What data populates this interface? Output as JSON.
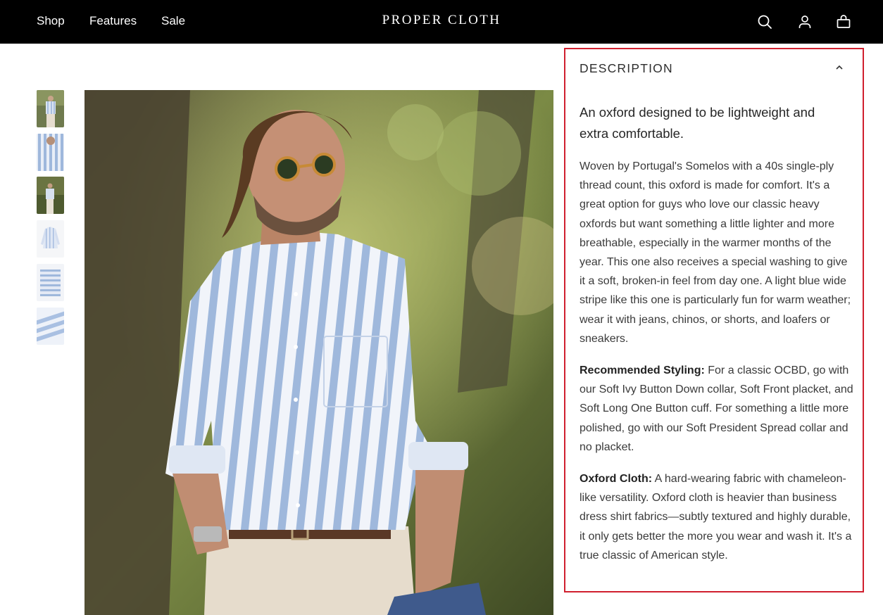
{
  "header": {
    "nav": [
      {
        "label": "Shop"
      },
      {
        "label": "Features"
      },
      {
        "label": "Sale"
      }
    ],
    "brand": "PROPER CLOTH",
    "icons": [
      "search-icon",
      "account-icon",
      "cart-icon"
    ]
  },
  "gallery": {
    "thumbnail_count": 6,
    "main_image": "man-wearing-blue-wide-stripe-oxford-shirt"
  },
  "description": {
    "title": "DESCRIPTION",
    "expanded": true,
    "lead": "An oxford designed to be lightweight and extra comfortable.",
    "body": "Woven by Portugal's Somelos with a 40s single-ply thread count, this oxford is made for comfort. It's a great option for guys who love our classic heavy oxfords but want something a little lighter and more breathable, especially in the warmer months of the year. This one also receives a special washing to give it a soft, broken-in feel from day one. A light blue wide stripe like this one is particularly fun for warm weather; wear it with jeans, chinos, or shorts, and loafers or sneakers.",
    "styling_label": "Recommended Styling:",
    "styling_text": " For a classic OCBD, go with our Soft Ivy Button Down collar, Soft Front placket, and Soft Long One Button cuff. For something a little more polished, go with our Soft President Spread collar and no placket.",
    "cloth_label": "Oxford Cloth:",
    "cloth_text": " A hard-wearing fabric with chameleon-like versatility. Oxford cloth is heavier than business dress shirt fabrics—subtly textured and highly durable, it only gets better the more you wear and wash it. It's a true classic of American style."
  },
  "colors": {
    "topbar": "#000000",
    "highlight_border": "#d01f2e",
    "stripe_blue": "#9fb8dc"
  }
}
